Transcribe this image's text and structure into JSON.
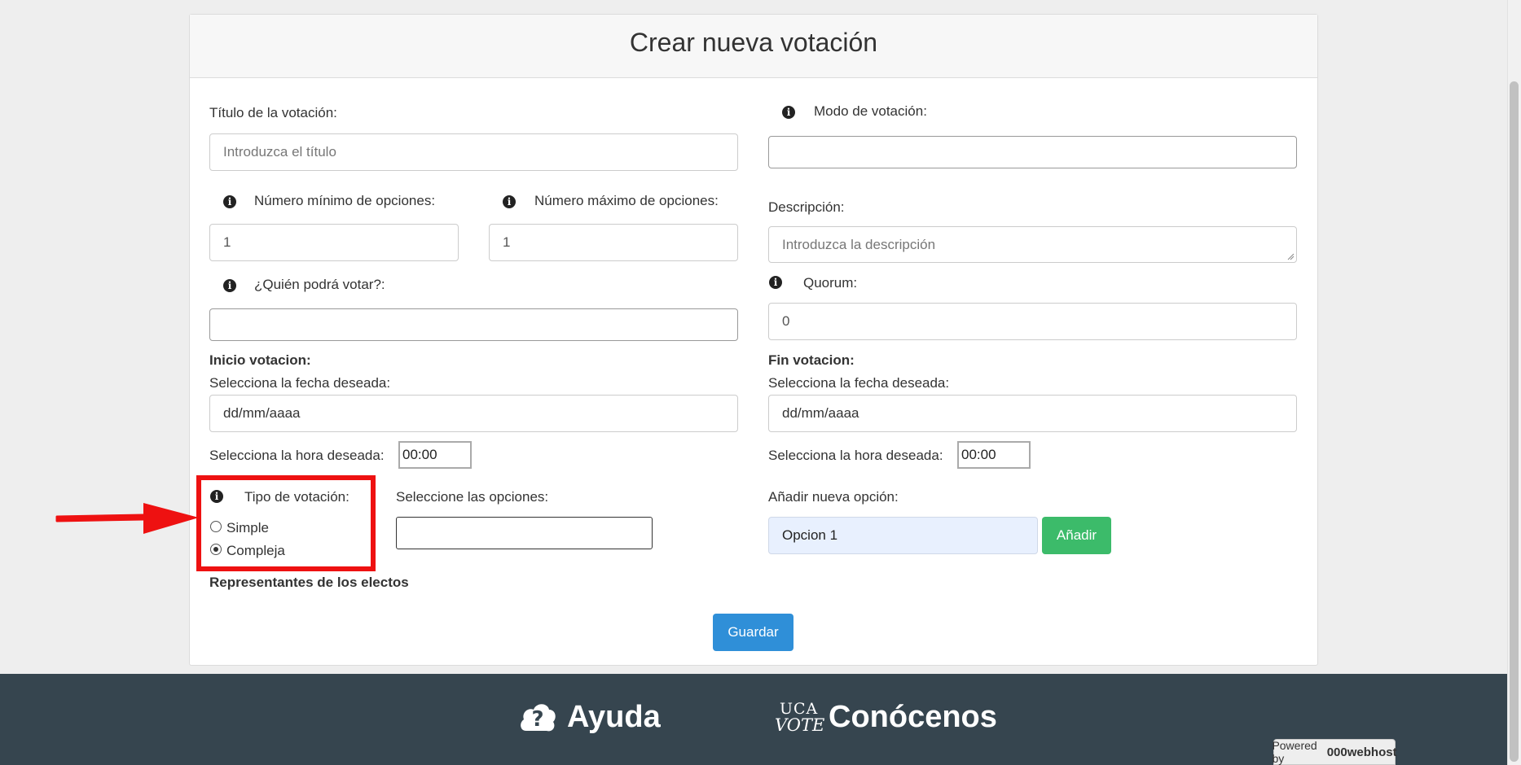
{
  "page_title": "Crear nueva votación",
  "form": {
    "titulo": {
      "label": "Título de la votación:",
      "placeholder": "Introduzca el título"
    },
    "modo": {
      "label": "Modo de votación:",
      "value": ""
    },
    "min_opciones": {
      "label": "Número mínimo de opciones:",
      "value": "1"
    },
    "max_opciones": {
      "label": "Número máximo de opciones:",
      "value": "1"
    },
    "descripcion": {
      "label": "Descripción:",
      "placeholder": "Introduzca la descripción"
    },
    "quien_vota": {
      "label": "¿Quién podrá votar?:",
      "value": ""
    },
    "quorum": {
      "label": "Quorum:",
      "value": "0"
    },
    "inicio": {
      "heading": "Inicio votacion:",
      "date_label": "Selecciona la fecha deseada:",
      "date_value": "dd/mm/aaaa",
      "time_label": "Selecciona la hora deseada:",
      "time_value": "00:00"
    },
    "fin": {
      "heading": "Fin votacion:",
      "date_label": "Selecciona la fecha deseada:",
      "date_value": "dd/mm/aaaa",
      "time_label": "Selecciona la hora deseada:",
      "time_value": "00:00"
    },
    "tipo": {
      "label": "Tipo de votación:",
      "options": [
        {
          "label": "Simple",
          "checked": false
        },
        {
          "label": "Compleja",
          "checked": true
        }
      ]
    },
    "seleccione_opciones": {
      "label": "Seleccione las opciones:",
      "value": ""
    },
    "nueva_opcion": {
      "label": "Añadir nueva opción:",
      "value": "Opcion 1",
      "button": "Añadir"
    },
    "representantes": "Representantes de los electos",
    "save_button": "Guardar"
  },
  "footer": {
    "help_label": "Ayuda",
    "about_label": "Conócenos",
    "logo_text_top": "UCA",
    "logo_text_bottom": "VOTE",
    "powered_by": "Powered by",
    "host_brand": "000webhost"
  },
  "colors": {
    "highlight": "#ee1111",
    "add_button": "#3cbb6a",
    "save_button": "#2f8fd8",
    "footer_bg": "#36454f",
    "selected_input_bg": "#e8f0fe"
  }
}
